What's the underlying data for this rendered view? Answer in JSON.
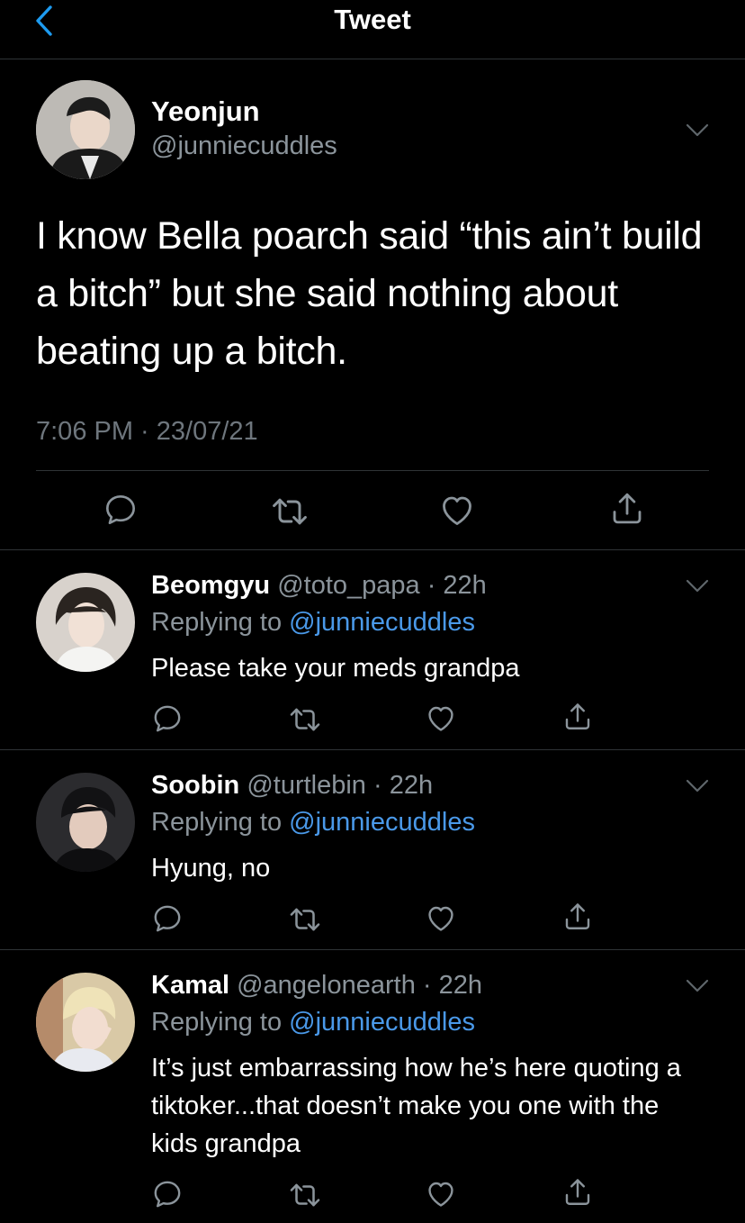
{
  "header": {
    "title": "Tweet",
    "back_icon": "chevron-left-icon"
  },
  "main_tweet": {
    "name": "Yeonjun",
    "handle": "@junniecuddles",
    "text": "I know Bella poarch said “this ain’t build a bitch” but she said nothing about beating up a bitch.",
    "timestamp": "7:06 PM · 23/07/21",
    "actions": [
      "reply-icon",
      "retweet-icon",
      "like-icon",
      "share-icon"
    ]
  },
  "replies": [
    {
      "name": "Beomgyu",
      "handle_time": "@toto_papa · 22h",
      "replying_prefix": "Replying to ",
      "replying_to": "@junniecuddles",
      "text": "Please take your meds grandpa"
    },
    {
      "name": "Soobin",
      "handle_time": "@turtlebin · 22h",
      "replying_prefix": "Replying to ",
      "replying_to": "@junniecuddles",
      "text": "Hyung, no"
    },
    {
      "name": "Kamal",
      "handle_time": "@angelonearth · 22h",
      "replying_prefix": "Replying to ",
      "replying_to": "@junniecuddles",
      "text": "It’s just embarrassing how he’s here quoting a tiktoker...that doesn’t make you one with the kids grandpa"
    }
  ],
  "colors": {
    "background": "#000000",
    "link": "#4a99e9",
    "muted": "#8b949b",
    "divider": "#2f3336",
    "back_arrow": "#1d9bf0"
  }
}
